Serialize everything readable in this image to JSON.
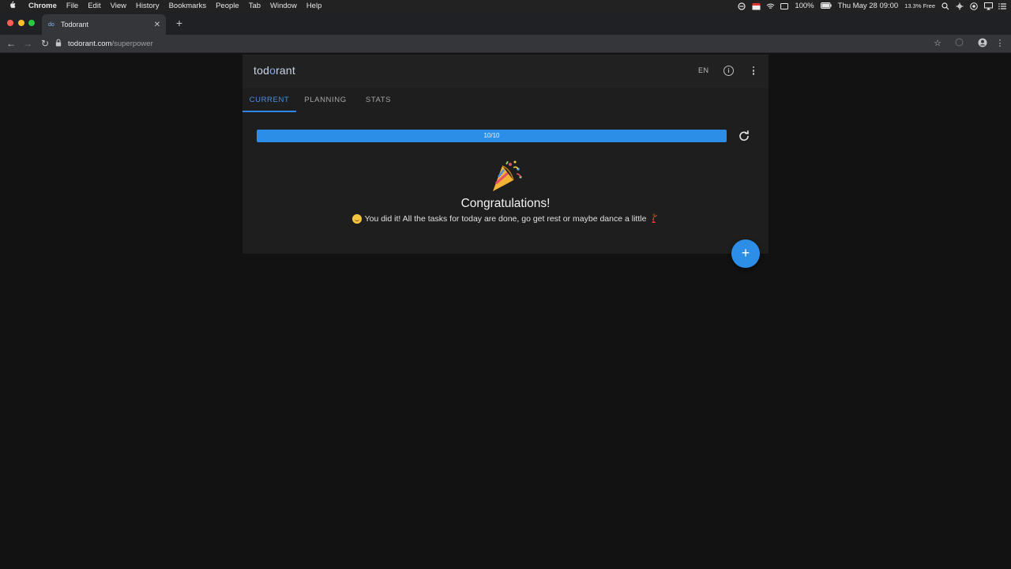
{
  "menubar": {
    "app_name": "Chrome",
    "items": [
      "File",
      "Edit",
      "View",
      "History",
      "Bookmarks",
      "People",
      "Tab",
      "Window",
      "Help"
    ],
    "battery": "100%",
    "datetime": "Thu May 28  09:00",
    "disk_free": "13.3% Free"
  },
  "browser": {
    "tab_title": "Todorant",
    "tab_favicon": "do",
    "url_domain": "todorant.com",
    "url_path": "/superpower"
  },
  "app": {
    "logo_prefix": "tod",
    "logo_o": "o",
    "logo_suffix": "rant",
    "language": "EN",
    "tabs": [
      {
        "label": "CURRENT",
        "active": true
      },
      {
        "label": "PLANNING",
        "active": false
      },
      {
        "label": "STATS",
        "active": false
      }
    ],
    "progress_label": "10/10",
    "progress_fraction": 1.0,
    "congrats_title": "Congratulations!",
    "congrats_text": "You did it! All the tasks for today are done, go get rest or maybe dance a little",
    "fab_label": "+"
  },
  "colors": {
    "accent": "#2d8ee7",
    "background": "#121212",
    "card": "#1e1e1e"
  }
}
